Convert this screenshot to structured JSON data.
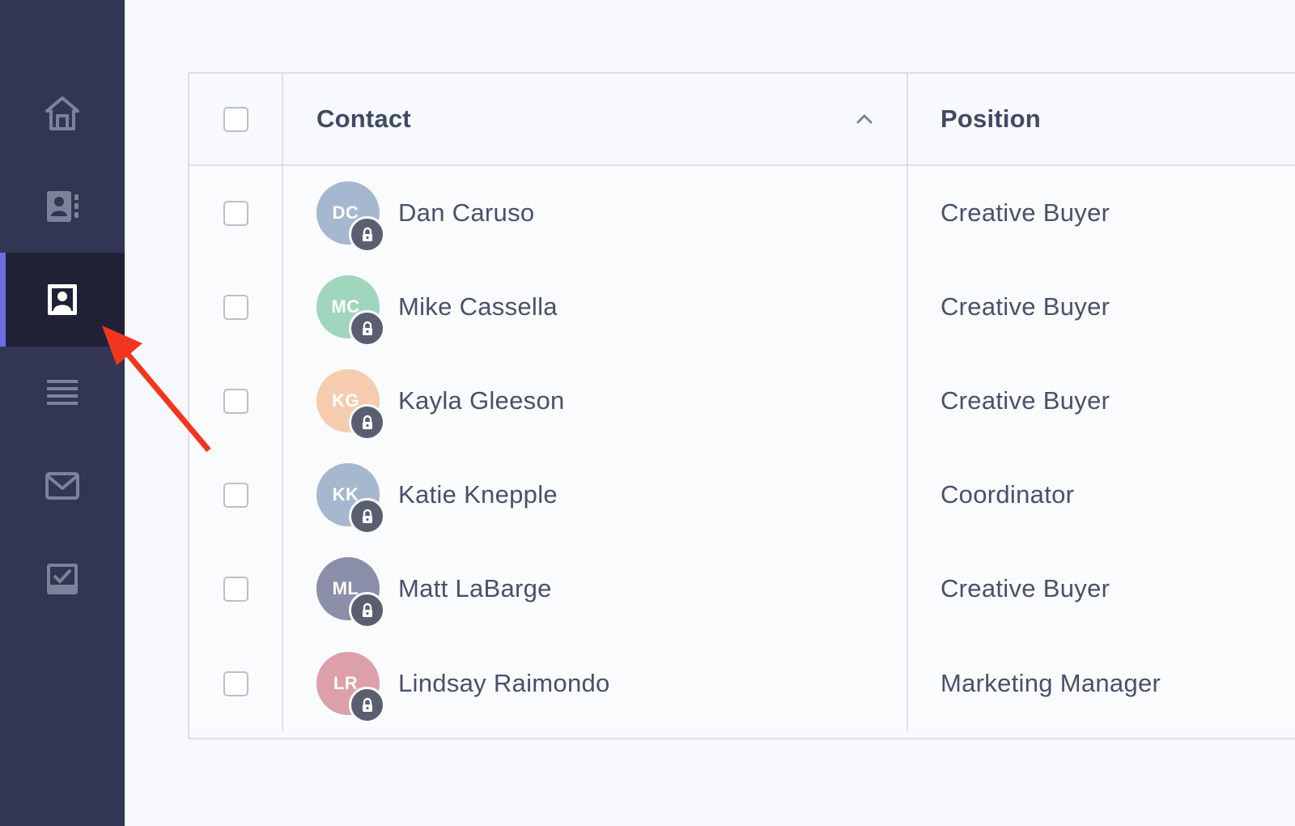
{
  "sidebar": {
    "items": [
      {
        "id": "home",
        "icon": "home-icon",
        "active": false
      },
      {
        "id": "address-book",
        "icon": "address-book-icon",
        "active": false
      },
      {
        "id": "contacts",
        "icon": "contact-card-icon",
        "active": true
      },
      {
        "id": "list",
        "icon": "list-icon",
        "active": false
      },
      {
        "id": "mail",
        "icon": "mail-icon",
        "active": false
      },
      {
        "id": "tasks",
        "icon": "task-check-icon",
        "active": false
      }
    ],
    "colors": {
      "background": "#323553",
      "active_background": "#1f2136",
      "active_indicator": "#6c6ee6",
      "icon": "#7e8299",
      "active_icon": "#ffffff"
    }
  },
  "table": {
    "columns": {
      "contact": "Contact",
      "position": "Position"
    },
    "sort": {
      "column": "contact",
      "direction": "ascending",
      "icon": "chevron-up-icon"
    },
    "rows": [
      {
        "initials": "DC",
        "name": "Dan Caruso",
        "position": "Creative Buyer",
        "avatar_color": "#a6b8cf",
        "locked": true
      },
      {
        "initials": "MC",
        "name": "Mike Cassella",
        "position": "Creative Buyer",
        "avatar_color": "#9fd6bd",
        "locked": true
      },
      {
        "initials": "KG",
        "name": "Kayla Gleeson",
        "position": "Creative Buyer",
        "avatar_color": "#f5ccad",
        "locked": true
      },
      {
        "initials": "KK",
        "name": "Katie Knepple",
        "position": "Coordinator",
        "avatar_color": "#a6b8cf",
        "locked": true
      },
      {
        "initials": "ML",
        "name": "Matt LaBarge",
        "position": "Creative Buyer",
        "avatar_color": "#8a8ea8",
        "locked": true
      },
      {
        "initials": "LR",
        "name": "Lindsay Raimondo",
        "position": "Marketing Manager",
        "avatar_color": "#dca0aa",
        "locked": true
      }
    ]
  },
  "annotation": {
    "type": "arrow",
    "color": "#f2361d",
    "points_to": "sidebar-item-contacts"
  }
}
